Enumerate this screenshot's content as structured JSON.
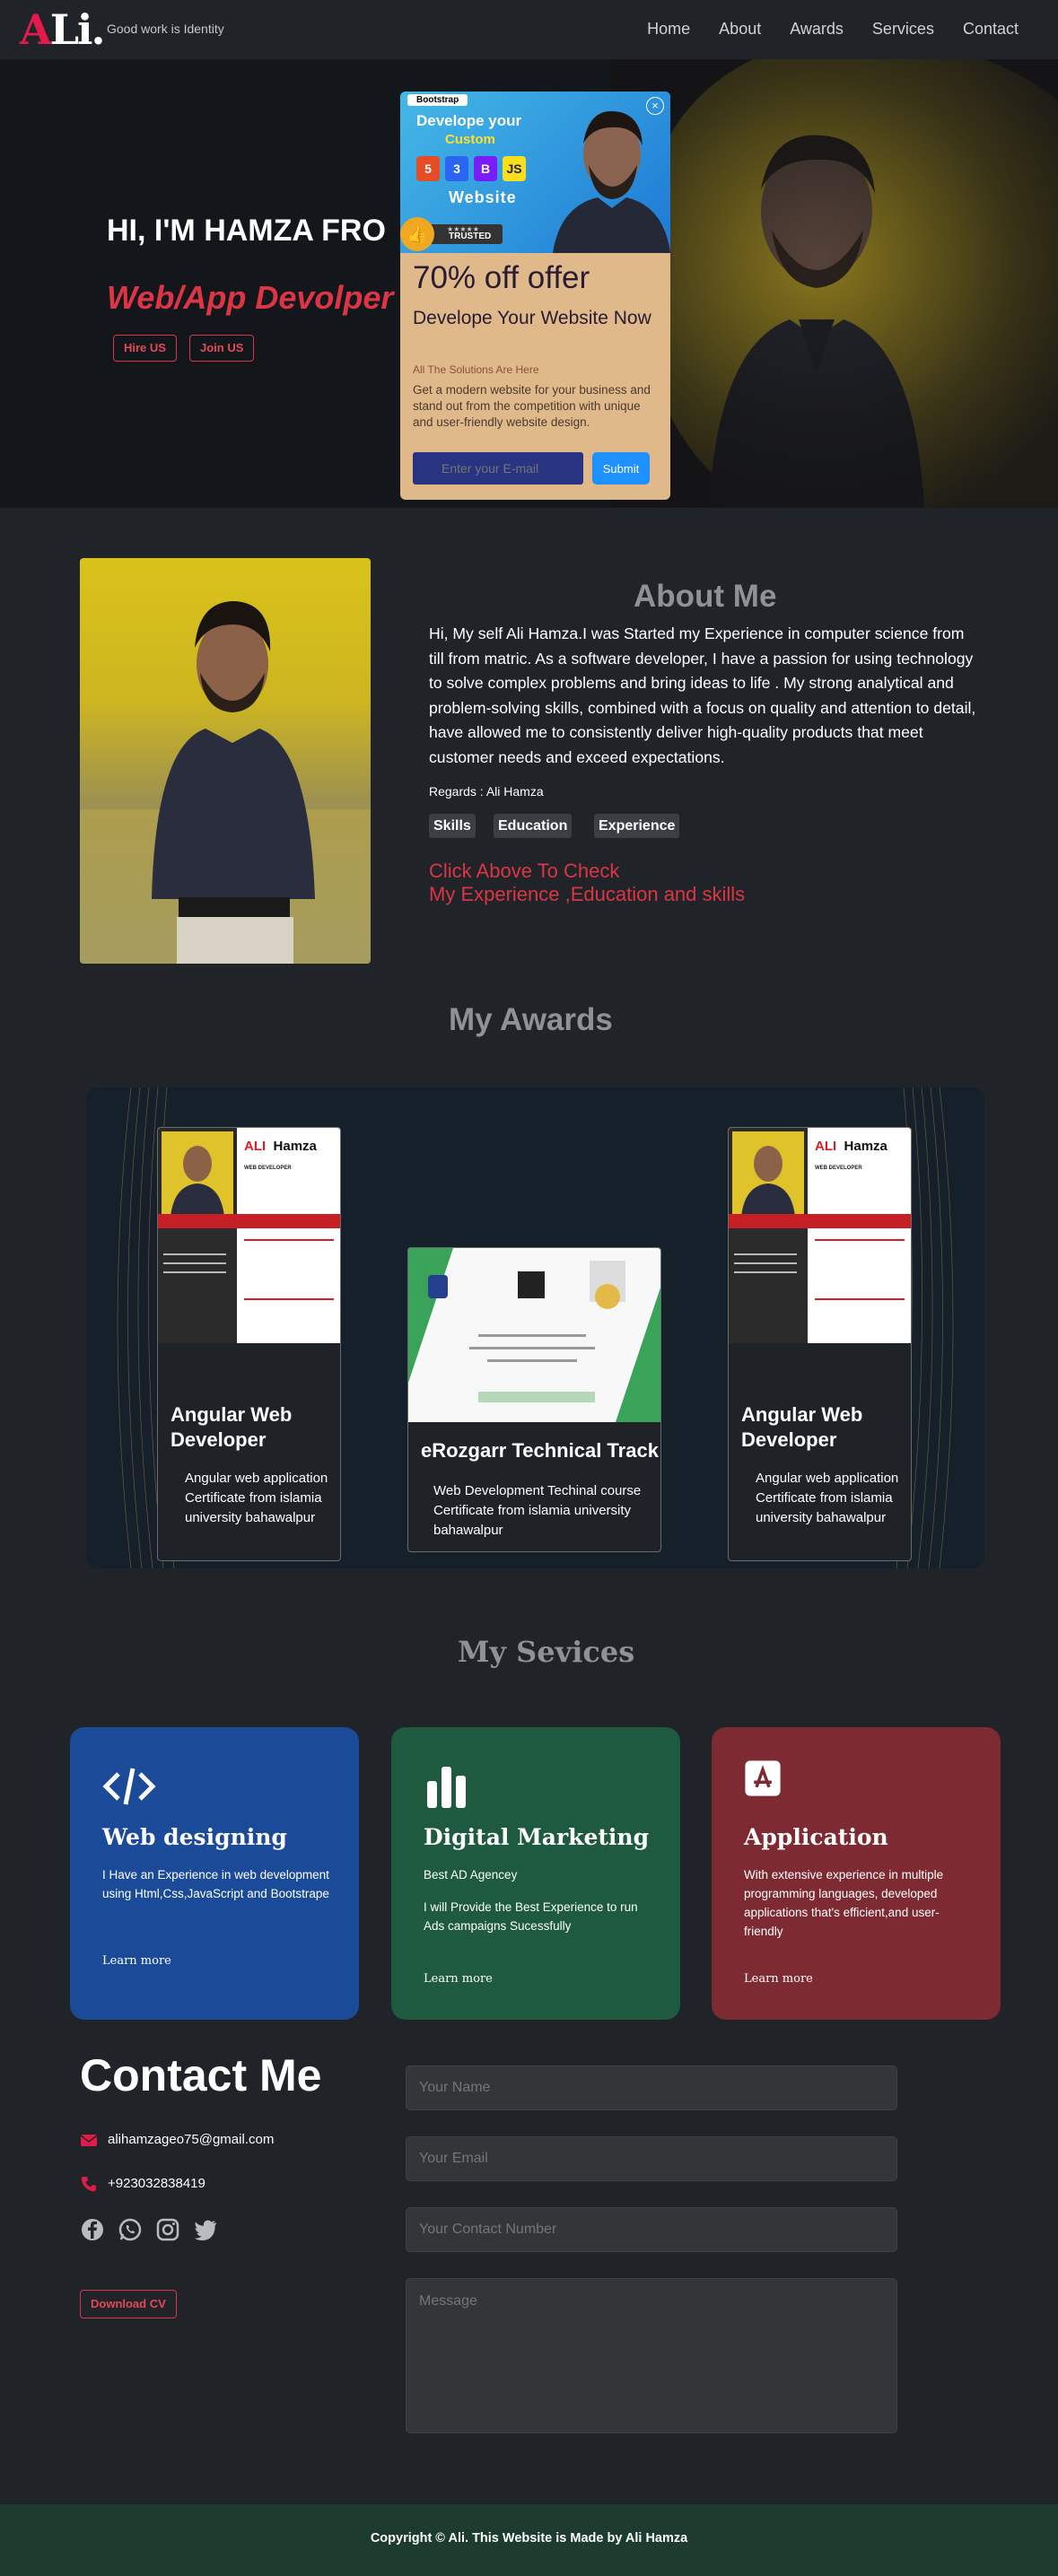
{
  "nav": {
    "logo_a": "A",
    "logo_li": "Li.",
    "tagline": "Good work is Identity",
    "links": [
      "Home",
      "About",
      "Awards",
      "Services",
      "Contact"
    ]
  },
  "hero": {
    "title": "HI, I'M HAMZA FRO",
    "role": "Web/App Devolper",
    "hire_btn": "Hire US",
    "join_btn": "Join US"
  },
  "popup": {
    "badge": "Bootstrap",
    "banner_line1": "Develope your",
    "banner_line2": "Custom",
    "tech": [
      "5",
      "3",
      "B",
      "JS"
    ],
    "banner_line3": "Website",
    "trusted": "TRUSTED",
    "stars": "★★★★★",
    "close": "×",
    "offer": "70% off offer",
    "heading": "Develope Your Website Now",
    "solutions": "All The Solutions Are Here",
    "description": "Get a modern website for your business and stand out from the competition with unique and user-friendly website design.",
    "email_placeholder": "Enter your E-mail",
    "submit": "Submit"
  },
  "about": {
    "title": "About Me",
    "text": "Hi, My self Ali Hamza.I was Started my Experience in computer science from till from matric. As a software developer, I have a passion for using technology to solve complex problems and bring ideas to life . My strong analytical and problem-solving skills, combined with a focus on quality and attention to detail, have allowed me to consistently deliver high-quality products that meet customer needs and exceed expectations.",
    "regards": "Regards : Ali Hamza",
    "tabs": [
      "Skills",
      "Education",
      "Experience"
    ],
    "click_line1": "Click Above To Check",
    "click_line2": "My Experience ,Education and skills"
  },
  "awards": {
    "title": "My Awards",
    "cards": [
      {
        "title": "Angular Web Developer",
        "desc": "Angular web application Certificate from islamia university bahawalpur",
        "cv_first": "ALI",
        "cv_last": "Hamza",
        "cv_role": "WEB DEVELOPER"
      },
      {
        "title": "eRozgarr Technical Track",
        "desc": "Web Development Techinal course Certificate from islamia university bahawalpur"
      },
      {
        "title": "Angular Web Developer",
        "desc": "Angular web application Certificate from islamia university bahawalpur",
        "cv_first": "ALI",
        "cv_last": "Hamza",
        "cv_role": "WEB DEVELOPER"
      }
    ]
  },
  "services": {
    "title": "My Sevices",
    "items": [
      {
        "title": "Web designing",
        "desc": "I Have an Experience in web development using Html,Css,JavaScript and Bootstrape",
        "link": "Learn more",
        "color": "#1a4a98"
      },
      {
        "title": "Digital Marketing",
        "desc_1": "Best AD Agencey",
        "desc_2": "I will Provide the Best Experience to run Ads campaigns Sucessfully",
        "link": "Learn more",
        "color": "#1d5a40"
      },
      {
        "title": "Application",
        "desc": "With extensive experience in multiple programming languages, developed applications that's efficient,and user-friendly",
        "link": "Learn more",
        "color": "#7d2a33"
      }
    ]
  },
  "contact": {
    "title": "Contact Me",
    "email": "alihamzageo75@gmail.com",
    "phone": "+923032838419",
    "download": "Download CV",
    "name_placeholder": "Your Name",
    "email_placeholder": "Your Email",
    "number_placeholder": "Your Contact Number",
    "message_placeholder": "Message"
  },
  "footer": {
    "text": "Copyright © Ali. This Website is Made by  Ali Hamza"
  }
}
